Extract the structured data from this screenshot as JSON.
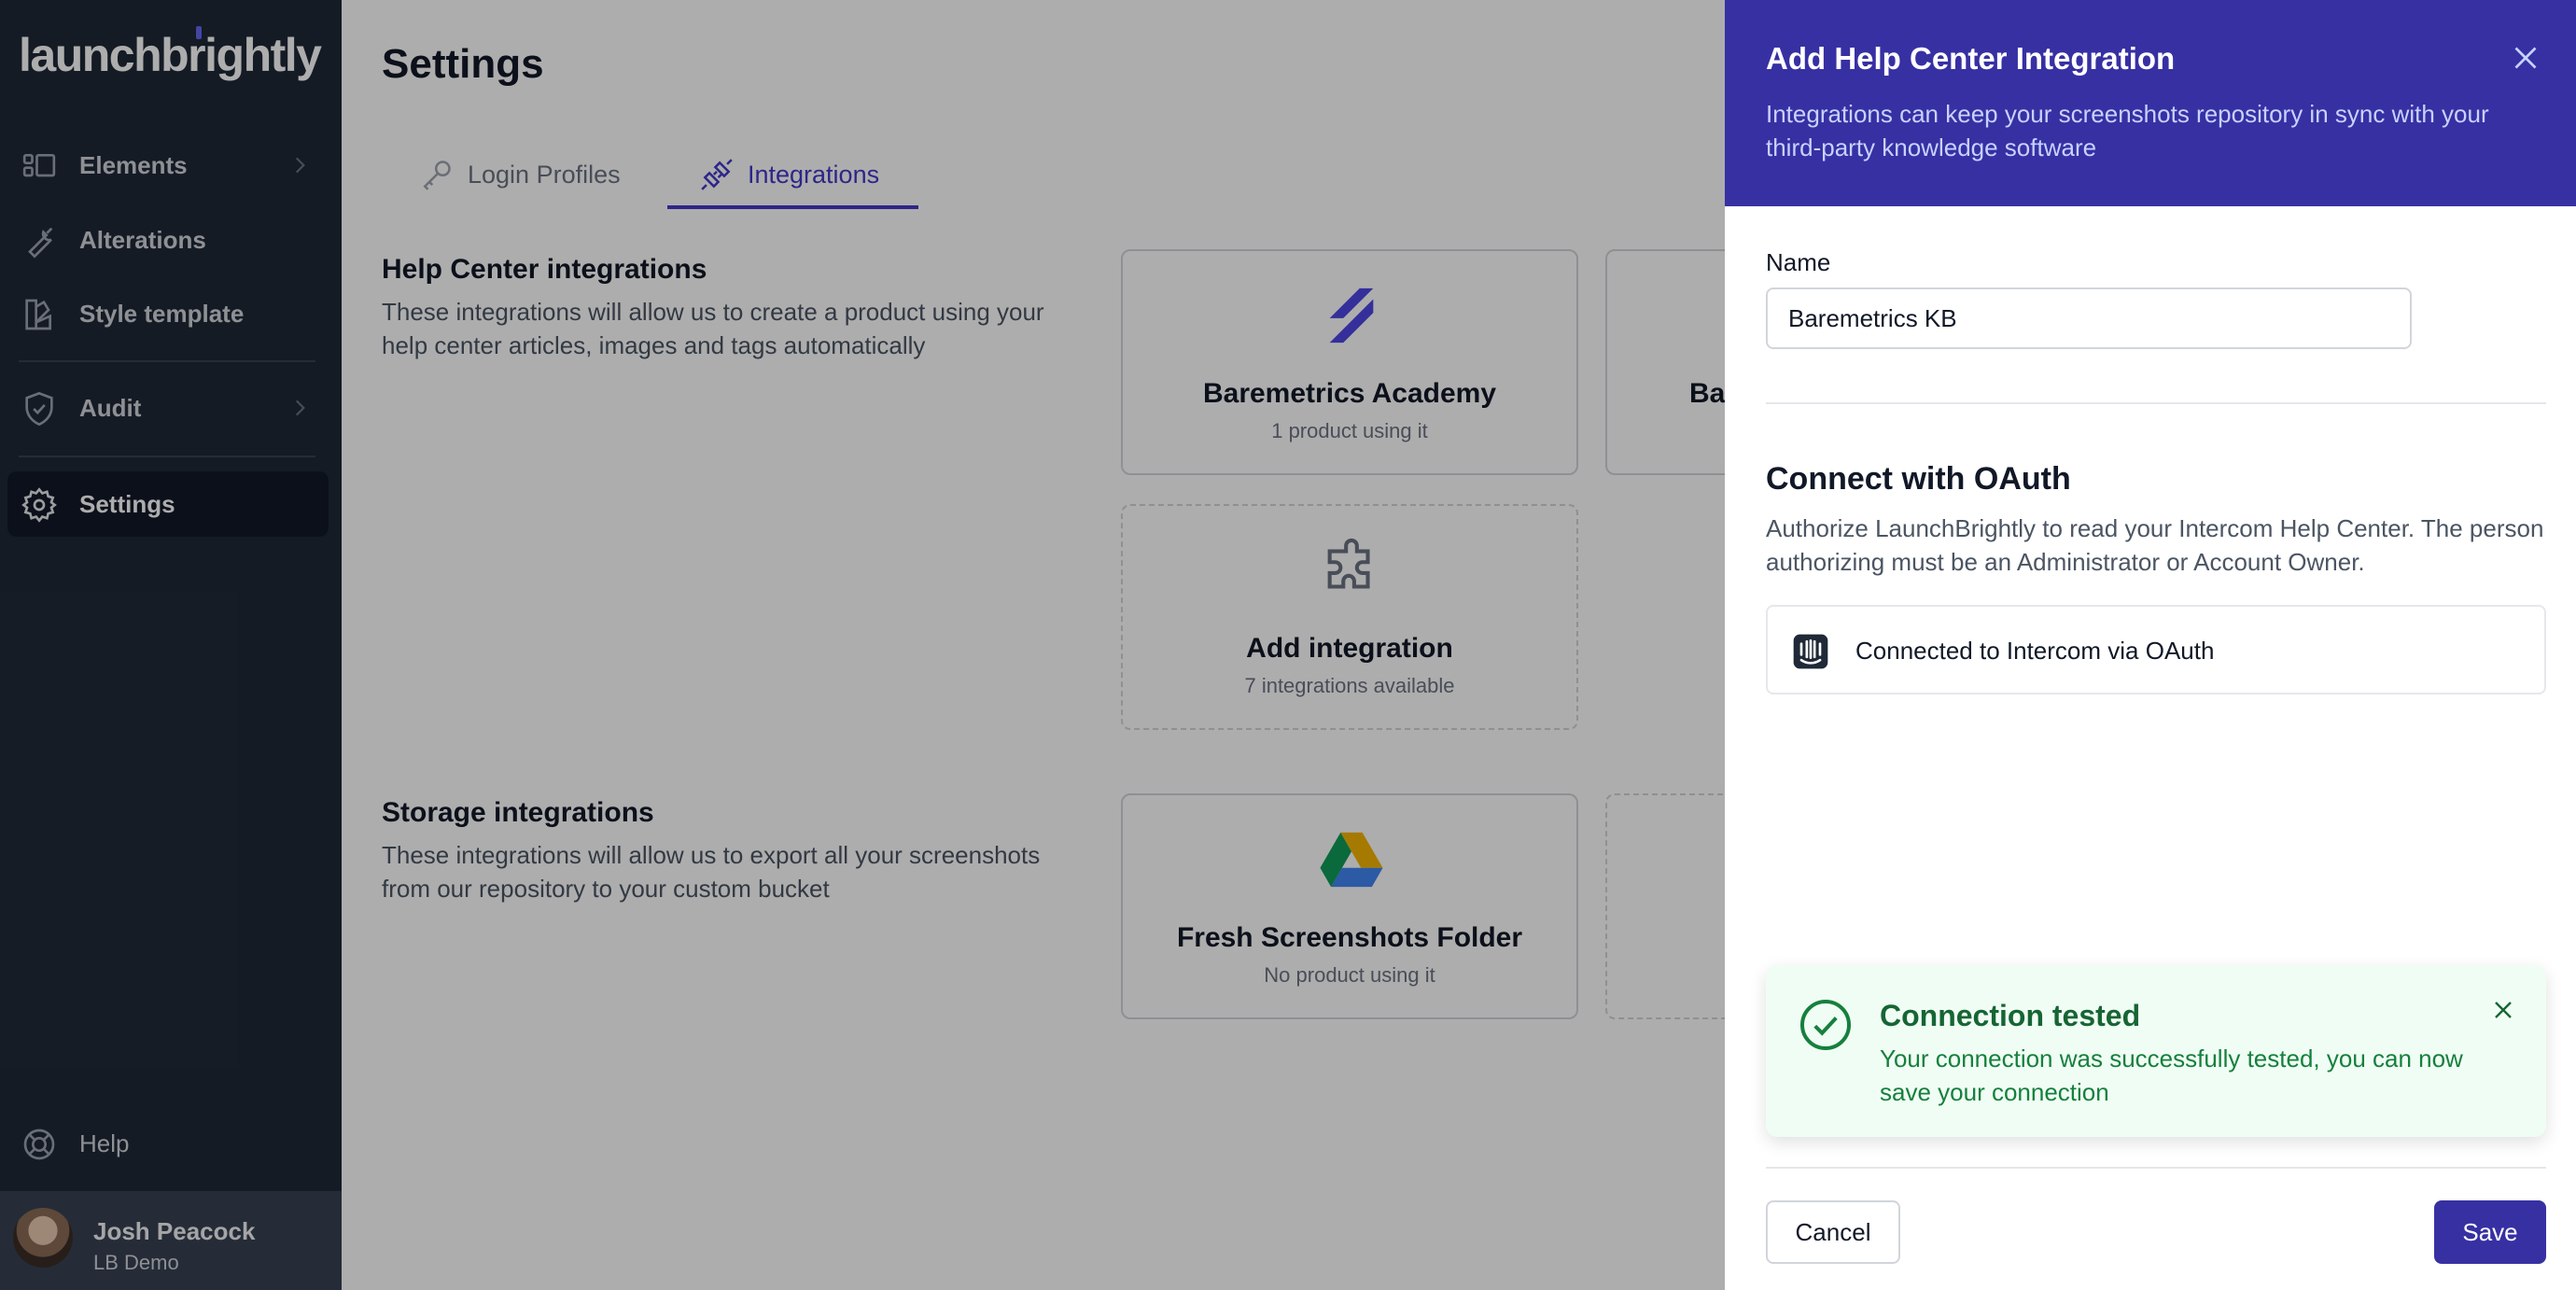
{
  "brand": {
    "logo_text": "launchbrightly",
    "accent": "#3730a3",
    "sidebar_bg": "#1f2937"
  },
  "sidebar": {
    "items": [
      {
        "label": "Elements",
        "icon": "elements-icon",
        "has_chevron": true
      },
      {
        "label": "Alterations",
        "icon": "wrench-icon",
        "has_chevron": false
      },
      {
        "label": "Style template",
        "icon": "swatch-icon",
        "has_chevron": false
      },
      {
        "label": "Audit",
        "icon": "shield-check-icon",
        "has_chevron": true
      },
      {
        "label": "Settings",
        "icon": "gear-icon",
        "has_chevron": false,
        "active": true
      }
    ],
    "help_label": "Help",
    "user": {
      "name": "Josh Peacock",
      "org": "LB Demo"
    }
  },
  "main": {
    "title": "Settings",
    "tabs": [
      {
        "label": "Login Profiles",
        "icon": "key-icon",
        "active": false
      },
      {
        "label": "Integrations",
        "icon": "plug-icon",
        "active": true
      }
    ],
    "help_center": {
      "title": "Help Center integrations",
      "description": "These integrations will allow us to create a product using your help center articles, images and tags automatically",
      "cards": [
        {
          "title": "Baremetrics Academy",
          "subtitle": "1 product using it",
          "icon": "zendesk-icon"
        },
        {
          "title": "Bar",
          "subtitle": "",
          "icon": ""
        },
        {
          "title": "Add integration",
          "subtitle": "7 integrations available",
          "icon": "puzzle-icon"
        }
      ]
    },
    "storage": {
      "title": "Storage integrations",
      "description": "These integrations will allow us to export all your screenshots from our repository to your custom bucket",
      "cards": [
        {
          "title": "Fresh Screenshots Folder",
          "subtitle": "No product using it",
          "icon": "google-drive-icon"
        }
      ]
    }
  },
  "panel": {
    "title": "Add Help Center Integration",
    "subtitle": "Integrations can keep your screenshots repository in sync with your third-party knowledge software",
    "name_label": "Name",
    "name_value": "Baremetrics KB",
    "oauth_title": "Connect with OAuth",
    "oauth_description": "Authorize LaunchBrightly to read your Intercom Help Center. The person authorizing must be an Administrator or Account Owner.",
    "oauth_status": "Connected to Intercom via OAuth",
    "toast": {
      "title": "Connection tested",
      "message": "Your connection was successfully tested, you can now save your connection"
    },
    "cancel_label": "Cancel",
    "save_label": "Save"
  }
}
